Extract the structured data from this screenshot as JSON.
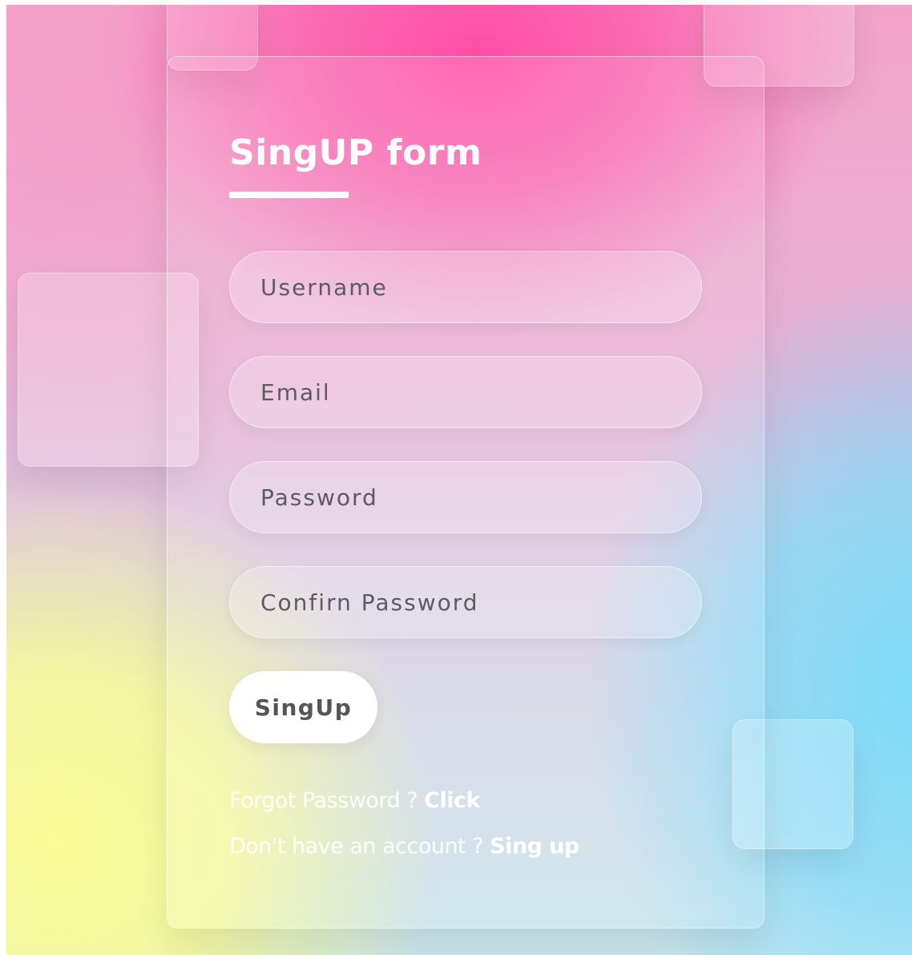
{
  "form": {
    "title": "SingUP form",
    "fields": {
      "username_placeholder": "Username",
      "email_placeholder": "Email",
      "password_placeholder": "Password",
      "confirm_password_placeholder": "Confirn Password"
    },
    "submit_label": "SingUp",
    "forgot_text": "Forgot Password ? ",
    "forgot_link": "Click",
    "account_text": "Don't have an account ? ",
    "signup_link": "Sing up"
  },
  "theme": {
    "pink": "#ff4fa7",
    "yellow": "#f9fb98",
    "cyan": "#7fdcfa",
    "text_white": "#ffffff",
    "text_grey": "#555555"
  }
}
